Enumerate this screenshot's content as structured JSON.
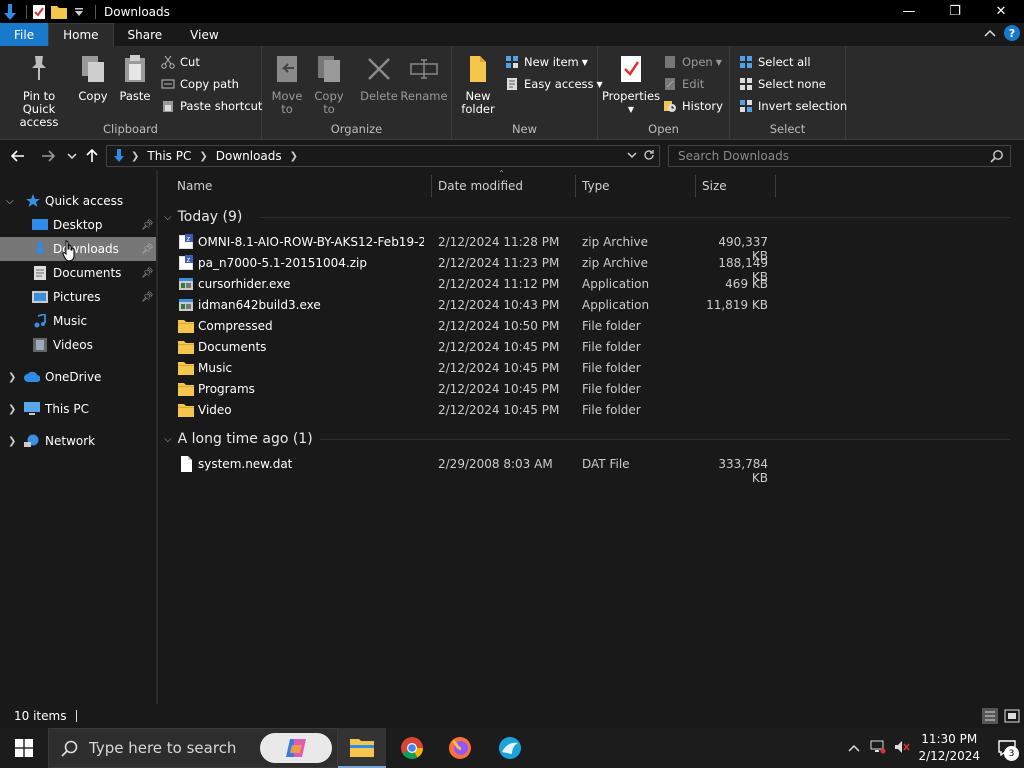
{
  "window": {
    "title": "Downloads",
    "minimize_glyph": "—",
    "maximize_glyph": "❐",
    "close_glyph": "✕"
  },
  "ribbon_tabs": [
    "File",
    "Home",
    "Share",
    "View"
  ],
  "ribbon": {
    "clipboard": {
      "label": "Clipboard",
      "pin": "Pin to Quick access",
      "copy": "Copy",
      "paste": "Paste",
      "cut": "Cut",
      "copy_path": "Copy path",
      "paste_shortcut": "Paste shortcut"
    },
    "organize": {
      "label": "Organize",
      "move_to": "Move to",
      "copy_to": "Copy to",
      "delete": "Delete",
      "rename": "Rename"
    },
    "new": {
      "label": "New",
      "new_folder": "New folder",
      "new_item": "New item",
      "easy_access": "Easy access"
    },
    "open": {
      "label": "Open",
      "properties": "Properties",
      "open": "Open",
      "edit": "Edit",
      "history": "History"
    },
    "select": {
      "label": "Select",
      "select_all": "Select all",
      "select_none": "Select none",
      "invert": "Invert selection"
    }
  },
  "address": {
    "crumbs": [
      "This PC",
      "Downloads"
    ],
    "search_placeholder": "Search Downloads"
  },
  "nav_pane": {
    "quick_access": "Quick access",
    "items": [
      "Desktop",
      "Downloads",
      "Documents",
      "Pictures",
      "Music",
      "Videos"
    ],
    "onedrive": "OneDrive",
    "this_pc": "This PC",
    "network": "Network"
  },
  "columns": {
    "name": "Name",
    "date": "Date modified",
    "type": "Type",
    "size": "Size"
  },
  "groups": [
    {
      "title": "Today (9)",
      "files": [
        {
          "name": "OMNI-8.1-AIO-ROW-BY-AKS12-Feb19-2...",
          "date": "2/12/2024 11:28 PM",
          "type": "zip Archive",
          "size": "490,337 KB",
          "icon": "zip"
        },
        {
          "name": "pa_n7000-5.1-20151004.zip",
          "date": "2/12/2024 11:23 PM",
          "type": "zip Archive",
          "size": "188,149 KB",
          "icon": "zip"
        },
        {
          "name": "cursorhider.exe",
          "date": "2/12/2024 11:12 PM",
          "type": "Application",
          "size": "469 KB",
          "icon": "exe"
        },
        {
          "name": "idman642build3.exe",
          "date": "2/12/2024 10:43 PM",
          "type": "Application",
          "size": "11,819 KB",
          "icon": "exe"
        },
        {
          "name": "Compressed",
          "date": "2/12/2024 10:50 PM",
          "type": "File folder",
          "size": "",
          "icon": "folder"
        },
        {
          "name": "Documents",
          "date": "2/12/2024 10:45 PM",
          "type": "File folder",
          "size": "",
          "icon": "folder"
        },
        {
          "name": "Music",
          "date": "2/12/2024 10:45 PM",
          "type": "File folder",
          "size": "",
          "icon": "folder"
        },
        {
          "name": "Programs",
          "date": "2/12/2024 10:45 PM",
          "type": "File folder",
          "size": "",
          "icon": "folder"
        },
        {
          "name": "Video",
          "date": "2/12/2024 10:45 PM",
          "type": "File folder",
          "size": "",
          "icon": "folder"
        }
      ]
    },
    {
      "title": "A long time ago (1)",
      "files": [
        {
          "name": "system.new.dat",
          "date": "2/29/2008 8:03 AM",
          "type": "DAT File",
          "size": "333,784 KB",
          "icon": "file"
        }
      ]
    }
  ],
  "status": {
    "items": "10 items"
  },
  "taskbar": {
    "search_placeholder": "Type here to search",
    "time": "11:30 PM",
    "date": "2/12/2024",
    "notifications": "3"
  },
  "colors": {
    "accent": "#1979ca",
    "folder": "#f4c64b",
    "selected": "#777777"
  }
}
